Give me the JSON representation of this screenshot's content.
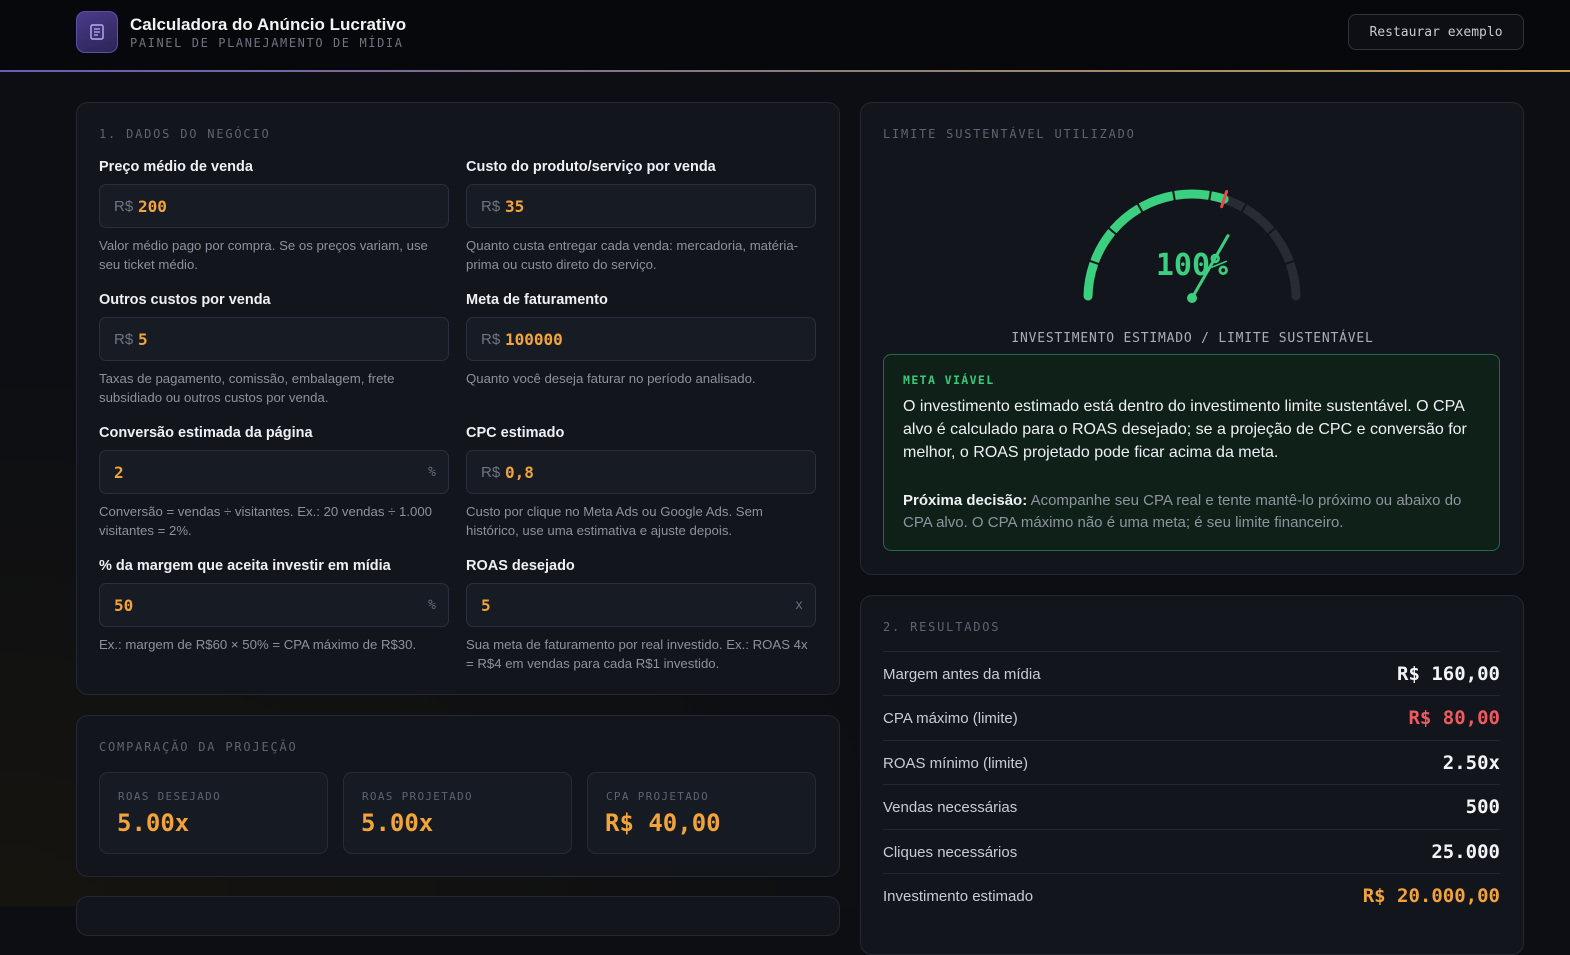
{
  "header": {
    "title": "Calculadora do Anúncio Lucrativo",
    "subtitle": "PAINEL DE PLANEJAMENTO DE MÍDIA",
    "reset_label": "Restaurar exemplo",
    "logo_icon": "document-icon"
  },
  "business": {
    "section_label": "1. DADOS DO NEGÓCIO",
    "fields": [
      {
        "label": "Preço médio de venda",
        "prefix": "R$",
        "value": "200",
        "suffix": "",
        "help": "Valor médio pago por compra. Se os preços variam, use seu ticket médio."
      },
      {
        "label": "Custo do produto/serviço por venda",
        "prefix": "R$",
        "value": "35",
        "suffix": "",
        "help": "Quanto custa entregar cada venda: mercadoria, matéria-prima ou custo direto do serviço."
      },
      {
        "label": "Outros custos por venda",
        "prefix": "R$",
        "value": "5",
        "suffix": "",
        "help": "Taxas de pagamento, comissão, embalagem, frete subsidiado ou outros custos por venda."
      },
      {
        "label": "Meta de faturamento",
        "prefix": "R$",
        "value": "100000",
        "suffix": "",
        "help": "Quanto você deseja faturar no período analisado."
      },
      {
        "label": "Conversão estimada da página",
        "prefix": "",
        "value": "2",
        "suffix": "%",
        "help": "Conversão = vendas ÷ visitantes. Ex.: 20 vendas ÷ 1.000 visitantes = 2%."
      },
      {
        "label": "CPC estimado",
        "prefix": "R$",
        "value": "0,8",
        "suffix": "",
        "help": "Custo por clique no Meta Ads ou Google Ads. Sem histórico, use uma estimativa e ajuste depois."
      },
      {
        "label": "% da margem que aceita investir em mídia",
        "prefix": "",
        "value": "50",
        "suffix": "%",
        "help": "Ex.: margem de R$60 × 50% = CPA máximo de R$30."
      },
      {
        "label": "ROAS desejado",
        "prefix": "",
        "value": "5",
        "suffix": "x",
        "help": "Sua meta de faturamento por real investido. Ex.: ROAS 4x = R$4 em vendas para cada R$1 investido."
      }
    ]
  },
  "comparison": {
    "section_label": "COMPARAÇÃO DA PROJEÇÃO",
    "cards": [
      {
        "label": "ROAS DESEJADO",
        "value": "5.00x"
      },
      {
        "label": "ROAS PROJETADO",
        "value": "5.00x"
      },
      {
        "label": "CPA PROJETADO",
        "value": "R$ 40,00"
      }
    ]
  },
  "gauge": {
    "section_label": "LIMITE SUSTENTÁVEL UTILIZADO",
    "percent_text": "100%",
    "fraction_used": 0.5,
    "caption": "INVESTIMENTO ESTIMADO / LIMITE SUSTENTÁVEL",
    "fill_color": "#3ad07f",
    "track_color": "#272b34",
    "marker_color": "#e5484d"
  },
  "status": {
    "tag": "META VIÁVEL",
    "message": "O investimento estimado está dentro do investimento limite sustentável. O CPA alvo é calculado para o ROAS desejado; se a projeção de CPC e conversão for melhor, o ROAS projetado pode ficar acima da meta.",
    "next_label": "Próxima decisão:",
    "next_text": "Acompanhe seu CPA real e tente mantê-lo próximo ou abaixo do CPA alvo. O CPA máximo não é uma meta; é seu limite financeiro."
  },
  "results": {
    "section_label": "2. RESULTADOS",
    "rows": [
      {
        "label": "Margem antes da mídia",
        "value": "R$ 160,00",
        "color": "#f3f4f6"
      },
      {
        "label": "CPA máximo (limite)",
        "value": "R$ 80,00",
        "color": "#ef5a5f"
      },
      {
        "label": "ROAS mínimo (limite)",
        "value": "2.50x",
        "color": "#f3f4f6"
      },
      {
        "label": "Vendas necessárias",
        "value": "500",
        "color": "#f3f4f6"
      },
      {
        "label": "Cliques necessários",
        "value": "25.000",
        "color": "#f3f4f6"
      },
      {
        "label": "Investimento estimado",
        "value": "R$ 20.000,00",
        "color": "#f2a33a"
      }
    ]
  }
}
